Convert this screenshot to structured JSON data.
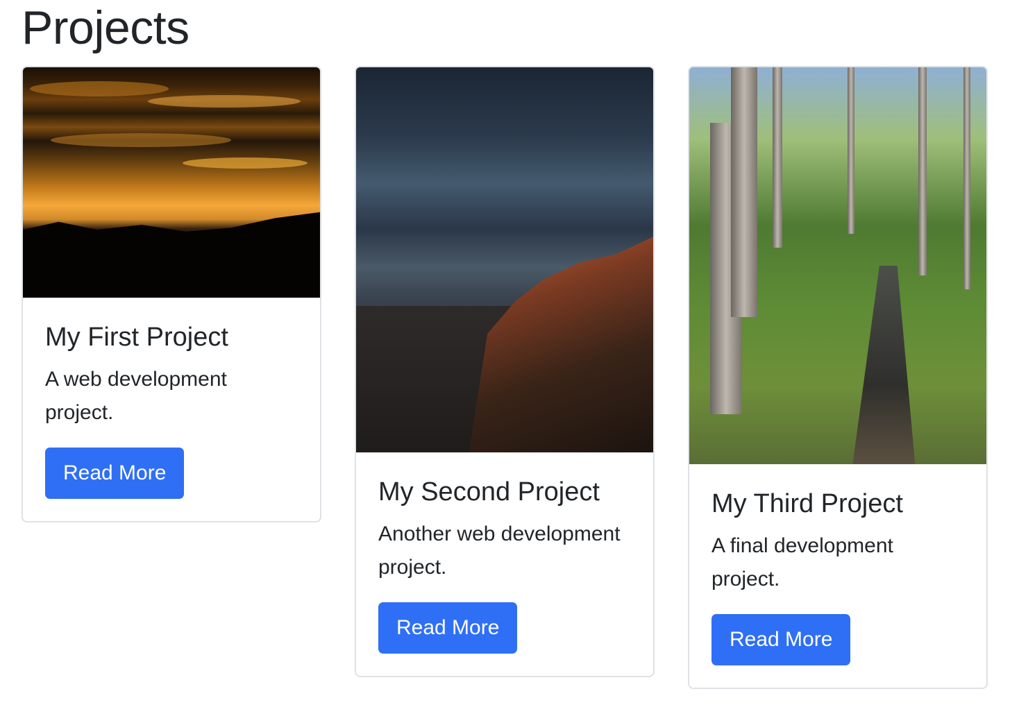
{
  "page": {
    "title": "Projects"
  },
  "projects": [
    {
      "image": "sunset-over-mountains-photo",
      "title": "My First Project",
      "description": "A web development project.",
      "button_label": "Read More"
    },
    {
      "image": "stormy-canyon-photo",
      "title": "My Second Project",
      "description": "Another web development project.",
      "button_label": "Read More"
    },
    {
      "image": "forest-creek-photo",
      "title": "My Third Project",
      "description": "A final development project.",
      "button_label": "Read More"
    }
  ],
  "colors": {
    "button": "#2f6ff5",
    "text": "#212529",
    "card_border": "#dee2e6"
  }
}
